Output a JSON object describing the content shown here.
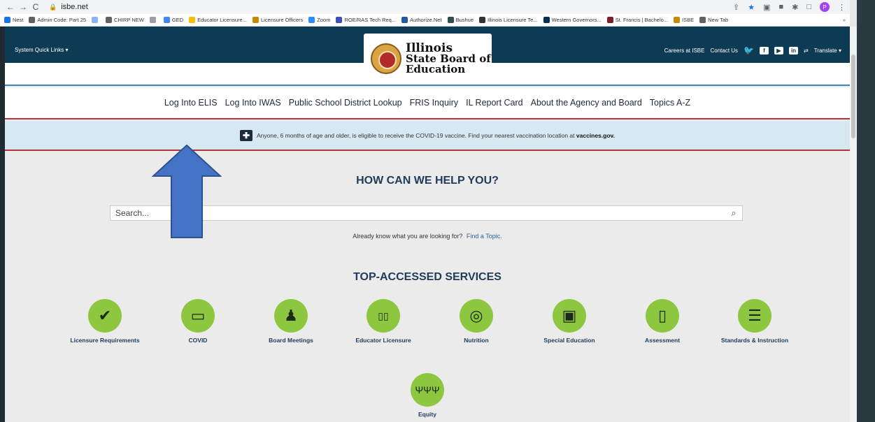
{
  "browser": {
    "url": "isbe.net",
    "bookmarks": [
      {
        "label": "Nest",
        "color": "#1a73e8"
      },
      {
        "label": "Admin Code: Part 25",
        "color": "#5f6368"
      },
      {
        "label": "",
        "color": "#8ab4f8"
      },
      {
        "label": "CHIRP NEW",
        "color": "#5f6368"
      },
      {
        "label": "",
        "color": "#9aa0a6"
      },
      {
        "label": "GED",
        "color": "#4285f4"
      },
      {
        "label": "Educator Licensure...",
        "color": "#fbbc04"
      },
      {
        "label": "Licensure Officers",
        "color": "#c58a00"
      },
      {
        "label": "Zoom",
        "color": "#2d8cff"
      },
      {
        "label": "ROE/RAS Tech Req...",
        "color": "#3f51b5"
      },
      {
        "label": "Authorize.Net",
        "color": "#1e5aa8"
      },
      {
        "label": "Bushue",
        "color": "#2f4f4f"
      },
      {
        "label": "Illinois Licensure Te...",
        "color": "#333333"
      },
      {
        "label": "Western Governors...",
        "color": "#003057"
      },
      {
        "label": "St. Francis | Bachelo...",
        "color": "#7a1f2b"
      },
      {
        "label": "ISBE",
        "color": "#c58a00"
      },
      {
        "label": "New Tab",
        "color": "#5f6368"
      }
    ],
    "bookmarks_more": "»",
    "profile_initial": "P"
  },
  "header": {
    "quick_links": "System Quick Links ▾",
    "careers": "Careers at ISBE",
    "contact": "Contact Us",
    "translate": "Translate ▾",
    "logo": {
      "line1": "Illinois",
      "line2": "State Board of",
      "line3": "Education"
    }
  },
  "nav": {
    "items": [
      "Log Into ELIS",
      "Log Into IWAS",
      "Public School District Lookup",
      "FRIS Inquiry",
      "IL Report Card",
      "About the Agency and Board",
      "Topics A-Z"
    ]
  },
  "alert": {
    "text": "Anyone, 6 months of age and older, is eligible to receive the COVID-19 vaccine. Find your nearest vaccination location at ",
    "link": "vaccines.gov."
  },
  "help": {
    "title": "HOW CAN WE HELP YOU?",
    "search_placeholder": "Search...",
    "known_text": "Already know what you are looking for?",
    "known_link": "Find a Topic."
  },
  "services": {
    "title": "TOP-ACCESSED SERVICES",
    "items": [
      {
        "label": "Licensure Requirements",
        "icon": "✔",
        "icon_name": "checkmark-icon"
      },
      {
        "label": "COVID",
        "icon": "▭",
        "icon_name": "mask-icon"
      },
      {
        "label": "Board Meetings",
        "icon": "♟",
        "icon_name": "podium-icon"
      },
      {
        "label": "Educator Licensure",
        "icon": "▯▯",
        "icon_name": "book-icon"
      },
      {
        "label": "Nutrition",
        "icon": "◎",
        "icon_name": "apple-icon"
      },
      {
        "label": "Special Education",
        "icon": "▣",
        "icon_name": "backpack-icon"
      },
      {
        "label": "Assessment",
        "icon": "▯",
        "icon_name": "clipboard-icon"
      },
      {
        "label": "Standards & Instruction",
        "icon": "☰",
        "icon_name": "notepad-icon"
      },
      {
        "label": "Equity",
        "icon": "ΨΨΨ",
        "icon_name": "people-icon"
      }
    ]
  },
  "colors": {
    "topbar": "#0e3b54",
    "service_green": "#8dc63f",
    "annotation_arrow": "#4472c4"
  }
}
